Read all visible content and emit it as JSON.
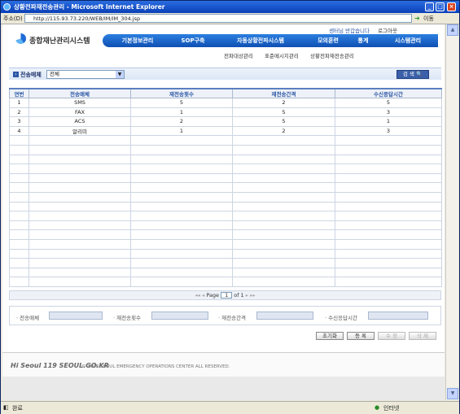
{
  "window": {
    "title": "상황전파재전송관리 - Microsoft Internet Explorer"
  },
  "address": {
    "label": "주소(D)",
    "url": "http://115.93.73.220/WEB/IM/IM_304.jsp",
    "go": "이동"
  },
  "toplinks": {
    "welcome": "센터님 반갑습니다",
    "logout": "로그아웃"
  },
  "logo": {
    "text": "종합재난관리시스템"
  },
  "nav": {
    "items": [
      "기본정보관리",
      "SOP구축",
      "자동상황전파시스템",
      "모의훈련",
      "통계",
      "시스템관리"
    ]
  },
  "subnav": {
    "items": [
      "전파대상관리",
      "표준메시지관리",
      "상황전파재전송관리"
    ]
  },
  "search": {
    "label": "전송매체",
    "select": "전체",
    "button": "검 색"
  },
  "table": {
    "headers": [
      "연번",
      "전송매체",
      "재전송횟수",
      "재전송간격",
      "수신응답시간"
    ],
    "rows": [
      [
        "1",
        "SMS",
        "5",
        "2",
        "5"
      ],
      [
        "2",
        "FAX",
        "1",
        "5",
        "3"
      ],
      [
        "3",
        "ACS",
        "2",
        "5",
        "1"
      ],
      [
        "4",
        "알리미",
        "1",
        "2",
        "3"
      ]
    ]
  },
  "pager": {
    "prefix": "Page",
    "page": "1",
    "suffix": "of 1"
  },
  "filters": {
    "labels": [
      "· 전송매체",
      "· 재전송횟수",
      "· 재전송간격",
      "· 수신응답시간"
    ]
  },
  "buttons": {
    "reset": "초기화",
    "register": "등 록",
    "edit": "수 정",
    "delete": "삭 제"
  },
  "footer": {
    "logo": "Hi Seoul 119 SEOUL.GO.KR",
    "copyright": "© 2008 SEOUL EMERGENCY OPERATIONS CENTER ALL RESERVED."
  },
  "statusbar": {
    "status": "완료",
    "zone": "인터넷"
  }
}
